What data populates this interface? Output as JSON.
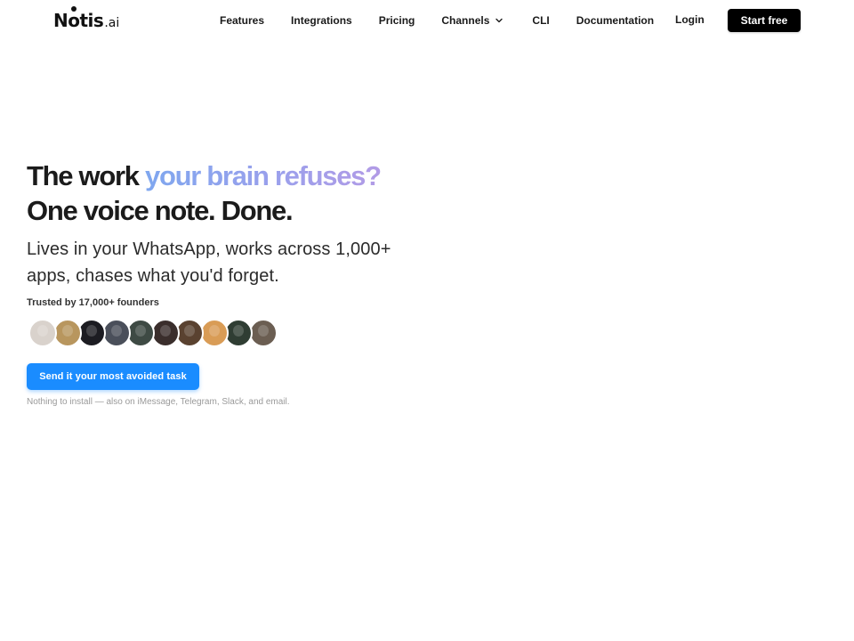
{
  "nav": {
    "logo_main": "Notis",
    "logo_suffix": ".ai",
    "links": [
      {
        "label": "Features"
      },
      {
        "label": "Integrations"
      },
      {
        "label": "Pricing"
      },
      {
        "label": "Channels",
        "icon": "chevron-down-icon"
      },
      {
        "label": "CLI"
      },
      {
        "label": "Documentation"
      }
    ],
    "login_label": "Login",
    "start_label": "Start free"
  },
  "hero": {
    "headline_part1": "The work ",
    "headline_highlight": "your brain refuses?",
    "headline_line2": "One voice note. Done.",
    "subheadline": "Lives in your WhatsApp, works across 1,000+ apps, chases what you'd forget.",
    "trusted_text": "Trusted by 17,000+ founders",
    "avatars": [
      {
        "color": "#d9d2cc"
      },
      {
        "color": "#b8965e"
      },
      {
        "color": "#1c1c22"
      },
      {
        "color": "#4a4f5a"
      },
      {
        "color": "#3e4a44"
      },
      {
        "color": "#3a2e2c"
      },
      {
        "color": "#5a4230"
      },
      {
        "color": "#d99c56"
      },
      {
        "color": "#2f3d33"
      },
      {
        "color": "#6b5e52"
      }
    ],
    "cta_label": "Send it your most avoided task",
    "footnote": "Nothing to install — also on iMessage, Telegram, Slack, and email."
  },
  "colors": {
    "accent": "#1a8cff",
    "gradient_start": "#7fa7ef",
    "gradient_end": "#b29be6"
  }
}
